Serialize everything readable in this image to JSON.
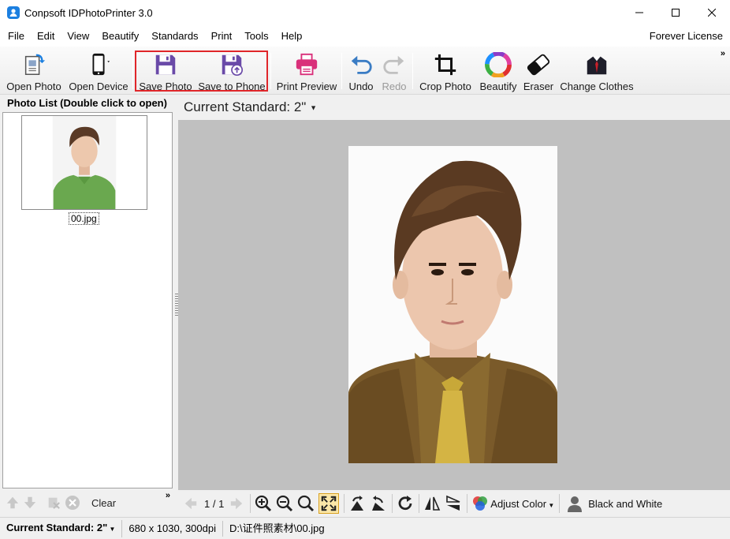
{
  "window": {
    "title": "Conpsoft IDPhotoPrinter 3.0"
  },
  "menu": {
    "items": [
      "File",
      "Edit",
      "View",
      "Beautify",
      "Standards",
      "Print",
      "Tools",
      "Help"
    ],
    "license": "Forever License"
  },
  "toolbar": {
    "open_photo": "Open Photo",
    "open_device": "Open Device",
    "save_photo": "Save Photo",
    "save_to_phone": "Save to Phone",
    "print_preview": "Print Preview",
    "undo": "Undo",
    "redo": "Redo",
    "crop_photo": "Crop Photo",
    "beautify": "Beautify",
    "eraser": "Eraser",
    "change_clothes": "Change Clothes",
    "more": "»"
  },
  "photo_list": {
    "header": "Photo List (Double click to open)",
    "items": [
      {
        "name": "00.jpg"
      }
    ],
    "clear_label": "Clear",
    "more": "»"
  },
  "main": {
    "current_standard_label": "Current Standard: 2\"",
    "page_indicator": "1 / 1",
    "adjust_color": "Adjust Color",
    "black_and_white": "Black and White"
  },
  "status": {
    "standard": "Current Standard: 2\"",
    "dimensions": "680 x 1030, 300dpi",
    "path": "D:\\证件照素材\\00.jpg"
  },
  "colors": {
    "accent_blue": "#1b7fe0",
    "highlight_red": "#e0262a",
    "save_purple": "#6a4aa8",
    "print_pink": "#d9307a",
    "canvas_gray": "#c0c0c0"
  }
}
